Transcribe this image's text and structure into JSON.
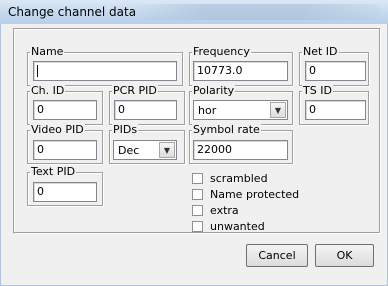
{
  "window": {
    "title": "Change channel data"
  },
  "fields": {
    "name": {
      "label": "Name",
      "value": ""
    },
    "frequency": {
      "label": "Frequency",
      "value": "10773.0"
    },
    "net_id": {
      "label": "Net ID",
      "value": "0"
    },
    "ch_id": {
      "label": "Ch. ID",
      "value": "0"
    },
    "pcr_pid": {
      "label": "PCR PID",
      "value": "0"
    },
    "polarity": {
      "label": "Polarity",
      "value": "hor"
    },
    "ts_id": {
      "label": "TS ID",
      "value": "0"
    },
    "video_pid": {
      "label": "Video PID",
      "value": "0"
    },
    "pids": {
      "label": "PIDs",
      "value": "Dec"
    },
    "symbol_rate": {
      "label": "Symbol rate",
      "value": "22000"
    },
    "text_pid": {
      "label": "Text PID",
      "value": "0"
    }
  },
  "checkboxes": [
    {
      "label": "scrambled",
      "checked": false
    },
    {
      "label": "Name protected",
      "checked": false
    },
    {
      "label": "extra",
      "checked": false
    },
    {
      "label": "unwanted",
      "checked": false
    }
  ],
  "buttons": {
    "cancel": "Cancel",
    "ok": "OK"
  }
}
